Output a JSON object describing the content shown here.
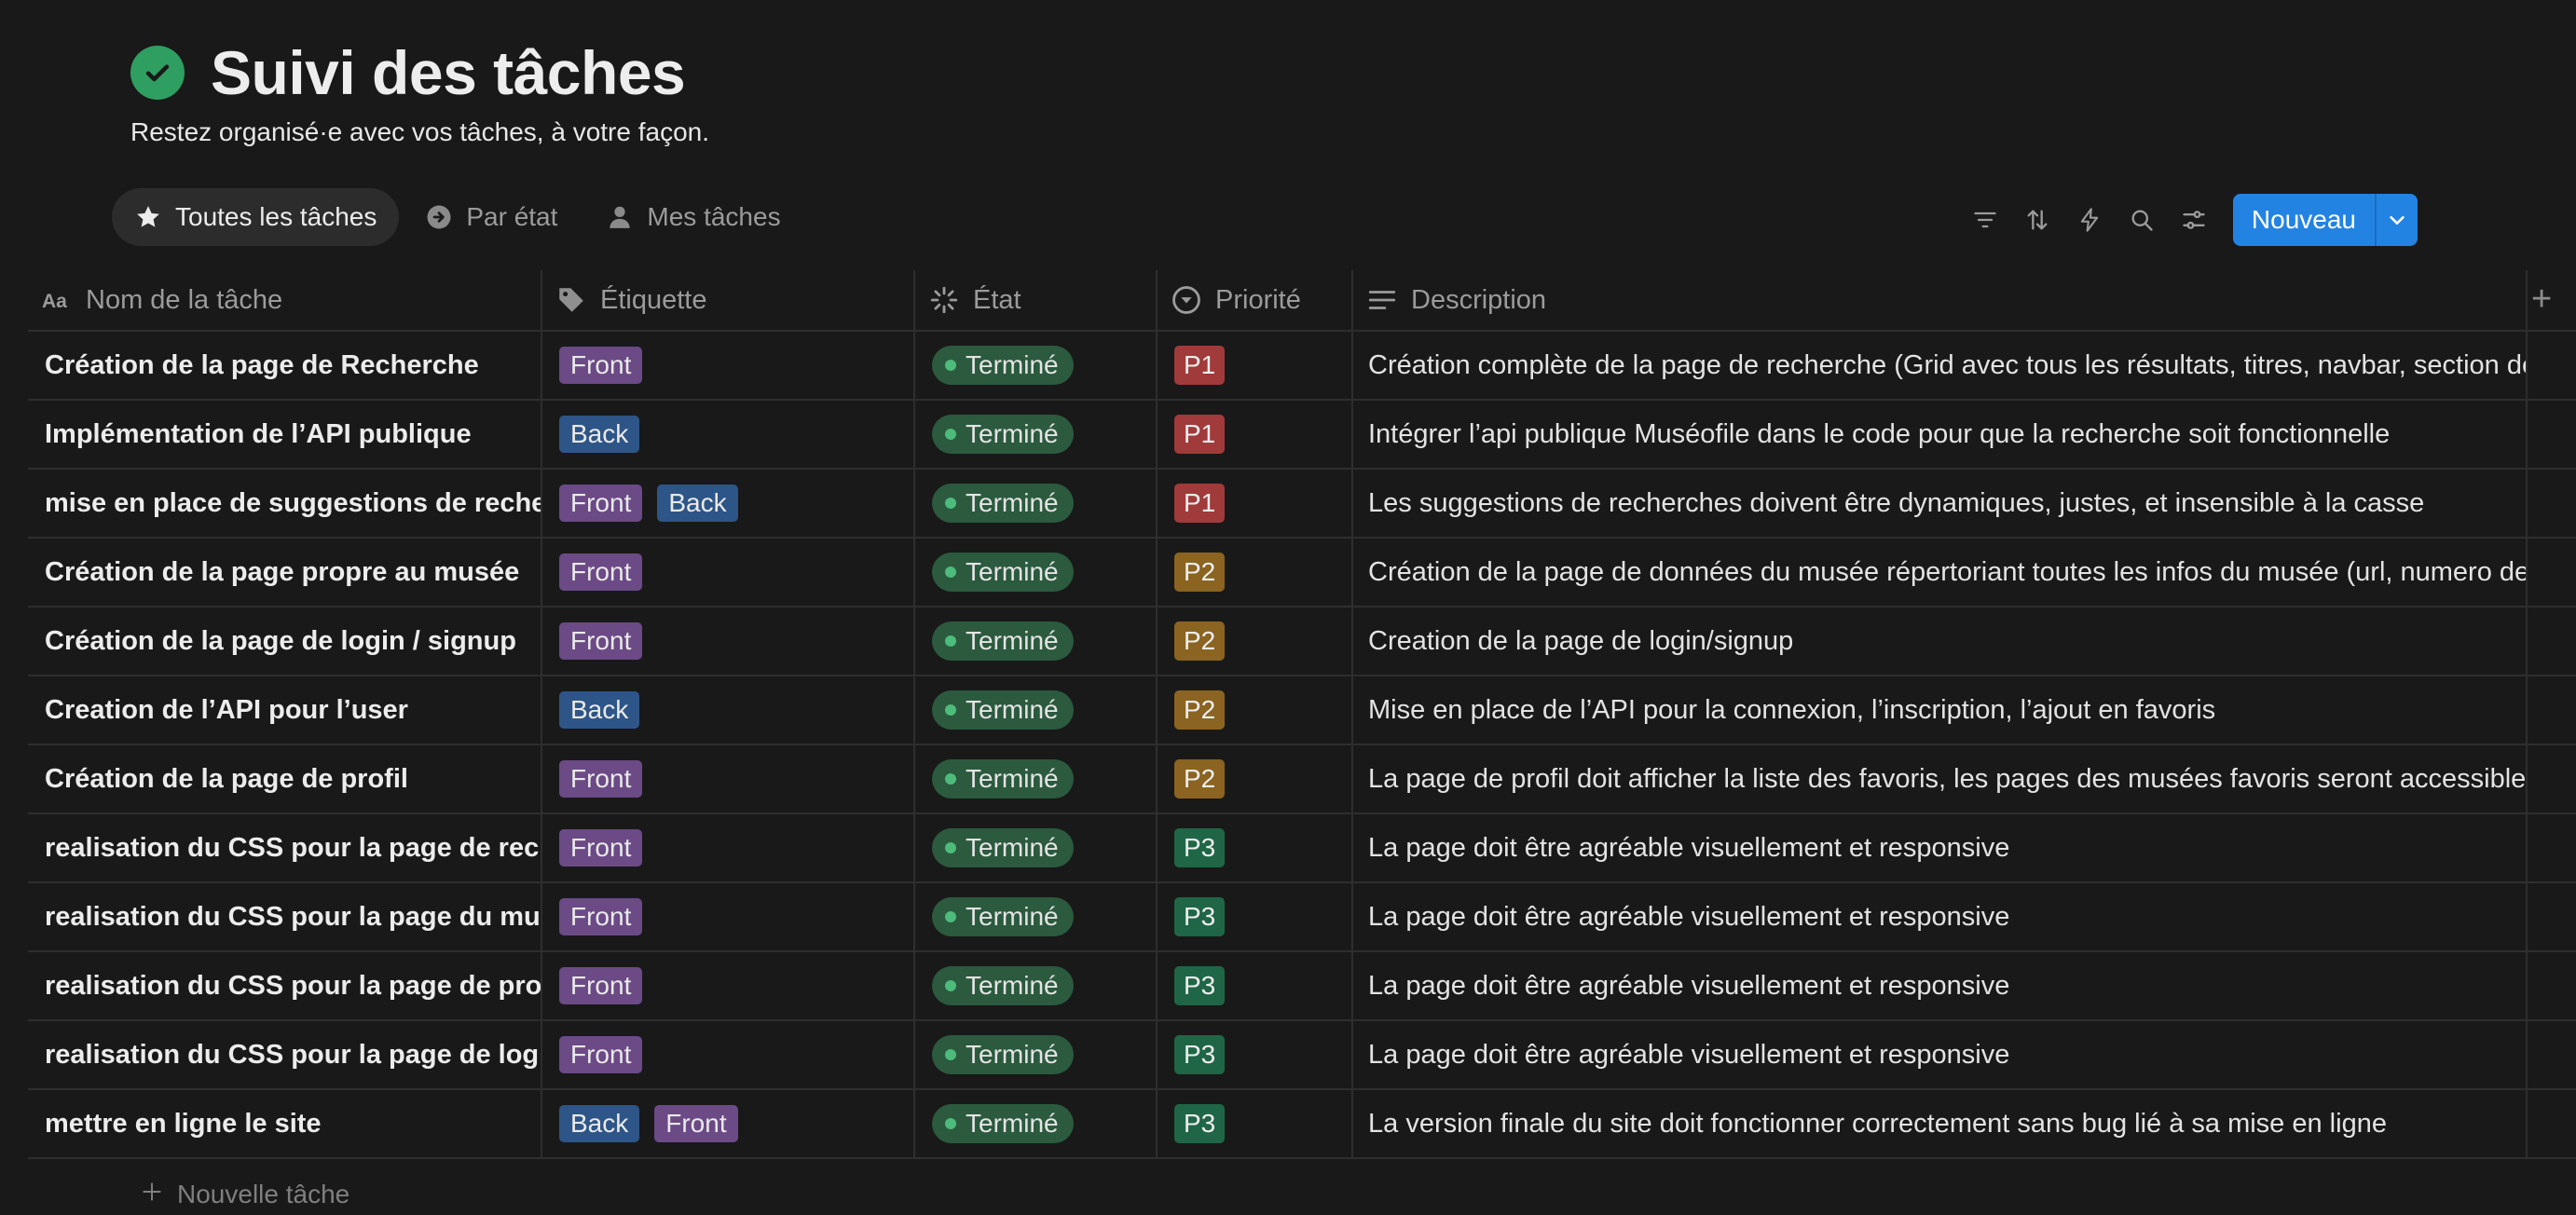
{
  "header": {
    "title": "Suivi des tâches",
    "subtitle": "Restez organisé·e avec vos tâches, à votre façon.",
    "accent": "#2f9e61"
  },
  "tabs": [
    {
      "label": "Toutes les tâches",
      "icon": "star-icon",
      "active": true
    },
    {
      "label": "Par état",
      "icon": "arrow-circle-icon",
      "active": false
    },
    {
      "label": "Mes tâches",
      "icon": "person-icon",
      "active": false
    }
  ],
  "toolbar": {
    "icons": [
      "filter-icon",
      "sort-icon",
      "lightning-icon",
      "search-icon",
      "settings-sliders-icon"
    ],
    "new_label": "Nouveau",
    "accent": "#2383e2"
  },
  "columns": {
    "name": "Nom de la tâche",
    "tag": "Étiquette",
    "state": "État",
    "priority": "Priorité",
    "description": "Description",
    "add": "+"
  },
  "rows": [
    {
      "name": "Création de la page de Recherche",
      "tags": [
        "Front"
      ],
      "state": "Terminé",
      "priority": "P1",
      "description": "Création complète de la page de recherche (Grid avec tous les résultats, titres, navbar, section de"
    },
    {
      "name": "Implémentation de l’API publique",
      "tags": [
        "Back"
      ],
      "state": "Terminé",
      "priority": "P1",
      "description": "Intégrer l’api publique Muséofile dans le code pour que la recherche soit fonctionnelle"
    },
    {
      "name": "mise en place de suggestions de recherche",
      "tags": [
        "Front",
        "Back"
      ],
      "state": "Terminé",
      "priority": "P1",
      "description": "Les suggestions de recherches doivent être dynamiques, justes, et insensible à la casse"
    },
    {
      "name": "Création de la page propre au musée",
      "tags": [
        "Front"
      ],
      "state": "Terminé",
      "priority": "P2",
      "description": "Création de la page de données du musée répertoriant toutes les infos du musée (url, numero de"
    },
    {
      "name": "Création de la page de login / signup",
      "tags": [
        "Front"
      ],
      "state": "Terminé",
      "priority": "P2",
      "description": "Creation de la page de login/signup"
    },
    {
      "name": "Creation de l’API pour l’user",
      "tags": [
        "Back"
      ],
      "state": "Terminé",
      "priority": "P2",
      "description": "Mise en place de l’API pour la connexion, l’inscription, l’ajout en favoris"
    },
    {
      "name": "Création de la page de profil",
      "tags": [
        "Front"
      ],
      "state": "Terminé",
      "priority": "P2",
      "description": "La page de profil doit afficher la liste des favoris, les pages des musées favoris seront accessibles"
    },
    {
      "name": "realisation du CSS pour la page de recherche",
      "tags": [
        "Front"
      ],
      "state": "Terminé",
      "priority": "P3",
      "description": "La page doit être agréable visuellement et responsive"
    },
    {
      "name": "realisation du CSS pour la page du musée",
      "tags": [
        "Front"
      ],
      "state": "Terminé",
      "priority": "P3",
      "description": "La page doit être agréable visuellement et responsive"
    },
    {
      "name": "realisation du CSS pour la page de profil",
      "tags": [
        "Front"
      ],
      "state": "Terminé",
      "priority": "P3",
      "description": "La page doit être agréable visuellement et responsive"
    },
    {
      "name": "realisation du CSS pour la page de login",
      "tags": [
        "Front"
      ],
      "state": "Terminé",
      "priority": "P3",
      "description": "La page doit être agréable visuellement et responsive"
    },
    {
      "name": "mettre en ligne le site",
      "tags": [
        "Back",
        "Front"
      ],
      "state": "Terminé",
      "priority": "P3",
      "description": "La version finale du site doit fonctionner correctement sans bug lié à sa mise en ligne"
    }
  ],
  "footer": {
    "new_task_label": "Nouvelle tâche"
  }
}
